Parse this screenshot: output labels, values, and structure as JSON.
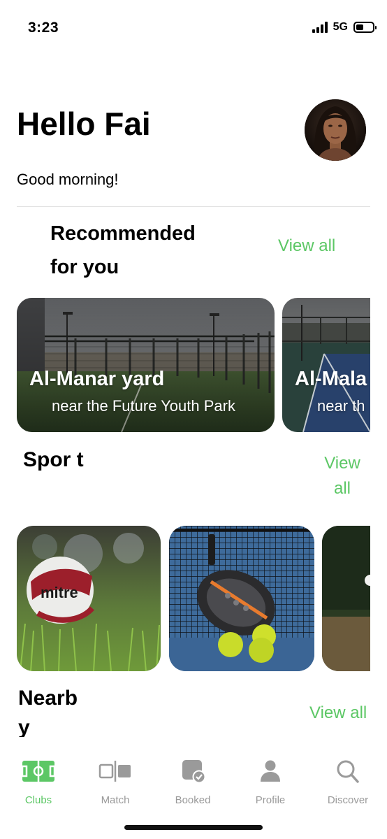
{
  "status_bar": {
    "time": "3:23",
    "network": "5G",
    "battery_level": 0.45
  },
  "header": {
    "title": "Hello Fai",
    "subtitle": "Good morning!"
  },
  "recommended": {
    "title": "Recommended for you",
    "view_all": "View all",
    "venues": [
      {
        "name": "Al-Manar yard",
        "location": "near the Future Youth Park"
      },
      {
        "name": "Al-Mala",
        "location": "near th"
      }
    ]
  },
  "sports": {
    "title": "Spor t",
    "view_all": "View all",
    "items": [
      {
        "image": "football",
        "brand_text": "mitre"
      },
      {
        "image": "padel-racket"
      },
      {
        "image": "tennis"
      }
    ]
  },
  "nearby": {
    "title": "Nearb y",
    "view_all": "View all"
  },
  "tab_bar": {
    "active": "Clubs",
    "accent_color": "#5cc765",
    "inactive_color": "#9a9a9a",
    "tabs": [
      {
        "label": "Clubs",
        "icon": "field-icon"
      },
      {
        "label": "Match",
        "icon": "versus-icon"
      },
      {
        "label": "Booked",
        "icon": "booked-calendar-icon"
      },
      {
        "label": "Profile",
        "icon": "person-icon"
      },
      {
        "label": "Discover",
        "icon": "search-icon"
      }
    ]
  }
}
